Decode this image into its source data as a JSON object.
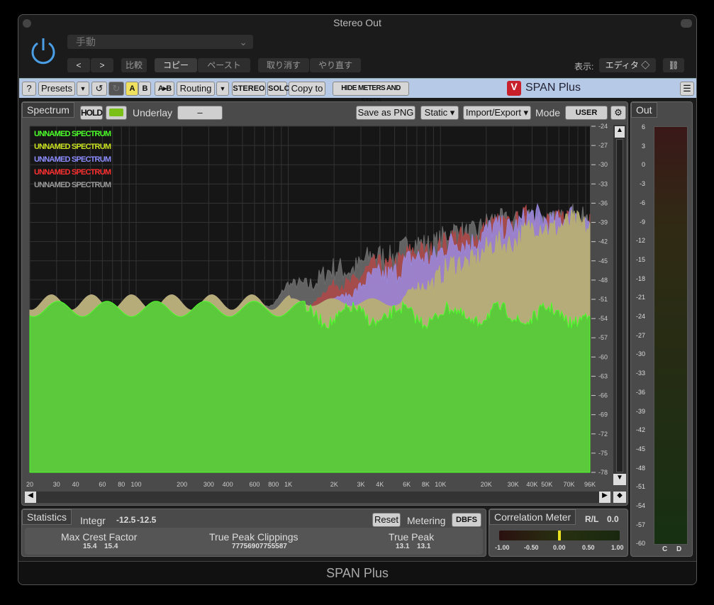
{
  "window": {
    "title": "Stereo Out",
    "footer": "SPAN Plus"
  },
  "host": {
    "preset": "手動",
    "prev": "<",
    "next": ">",
    "compare": "比較",
    "copy": "コピー",
    "paste": "ペースト",
    "undo": "取り消す",
    "redo": "やり直す",
    "view_label": "表示:",
    "view_value": "エディタ ◇"
  },
  "toolbar": {
    "help": "?",
    "presets": "Presets",
    "a": "A",
    "b": "B",
    "ab": "A▸B",
    "routing": "Routing",
    "stereo": "STEREO",
    "solo": "SOLO",
    "copy_to": "Copy to",
    "hide": "HIDE METERS AND STATS",
    "brand": "SPAN Plus"
  },
  "spectrum": {
    "tab": "Spectrum",
    "hold": "HOLD",
    "underlay_label": "Underlay",
    "underlay_value": "–",
    "save": "Save as PNG",
    "static": "Static ▾",
    "import": "Import/Export ▾",
    "mode_label": "Mode",
    "mode_value": "USER",
    "legend": [
      {
        "name": "UNNAMED SPECTRUM",
        "color": "#4cff2a"
      },
      {
        "name": "UNNAMED SPECTRUM",
        "color": "#c8e020"
      },
      {
        "name": "UNNAMED SPECTRUM",
        "color": "#8c8cff"
      },
      {
        "name": "UNNAMED SPECTRUM",
        "color": "#ff3030"
      },
      {
        "name": "UNNAMED SPECTRUM",
        "color": "#9a9a9a"
      }
    ],
    "db_ticks": [
      "-24",
      "-27",
      "-30",
      "-33",
      "-36",
      "-39",
      "-42",
      "-45",
      "-48",
      "-51",
      "-54",
      "-57",
      "-60",
      "-63",
      "-66",
      "-69",
      "-72",
      "-75",
      "-78"
    ],
    "freq_ticks": [
      [
        "20",
        20
      ],
      [
        "30",
        30
      ],
      [
        "40",
        40
      ],
      [
        "60",
        60
      ],
      [
        "80",
        80
      ],
      [
        "100",
        100
      ],
      [
        "200",
        200
      ],
      [
        "300",
        300
      ],
      [
        "400",
        400
      ],
      [
        "600",
        600
      ],
      [
        "800",
        800
      ],
      [
        "1K",
        1000
      ],
      [
        "2K",
        2000
      ],
      [
        "3K",
        3000
      ],
      [
        "4K",
        4000
      ],
      [
        "6K",
        6000
      ],
      [
        "8K",
        8000
      ],
      [
        "10K",
        10000
      ],
      [
        "20K",
        20000
      ],
      [
        "30K",
        30000
      ],
      [
        "40K",
        40000
      ],
      [
        "50K",
        50000
      ],
      [
        "70K",
        70000
      ],
      [
        "96K",
        96000
      ]
    ]
  },
  "stats": {
    "tab": "Statistics",
    "integr_label": "Integr",
    "integr_l": "-12.5",
    "integr_r": "-12.5",
    "reset": "Reset",
    "metering_label": "Metering",
    "metering_value": "DBFS",
    "crest_label": "Max Crest Factor",
    "crest_l": "15.4",
    "crest_r": "15.4",
    "clip_label": "True Peak Clippings",
    "clip_value": "77756907755587",
    "tp_label": "True Peak",
    "tp_l": "13.1",
    "tp_r": "13.1"
  },
  "correlation": {
    "title": "Correlation Meter",
    "mode": "R/L",
    "value": "0.0",
    "ticks": [
      "-1.00",
      "-0.50",
      "0.00",
      "0.50",
      "1.00"
    ],
    "level": 0.0
  },
  "out": {
    "title": "Out",
    "ticks": [
      "6",
      "3",
      "0",
      "-3",
      "-6",
      "-9",
      "-12",
      "-15",
      "-18",
      "-21",
      "-24",
      "-27",
      "-30",
      "-33",
      "-36",
      "-39",
      "-42",
      "-45",
      "-48",
      "-51",
      "-54",
      "-57",
      "-60"
    ],
    "ch": [
      "C",
      "D"
    ]
  }
}
